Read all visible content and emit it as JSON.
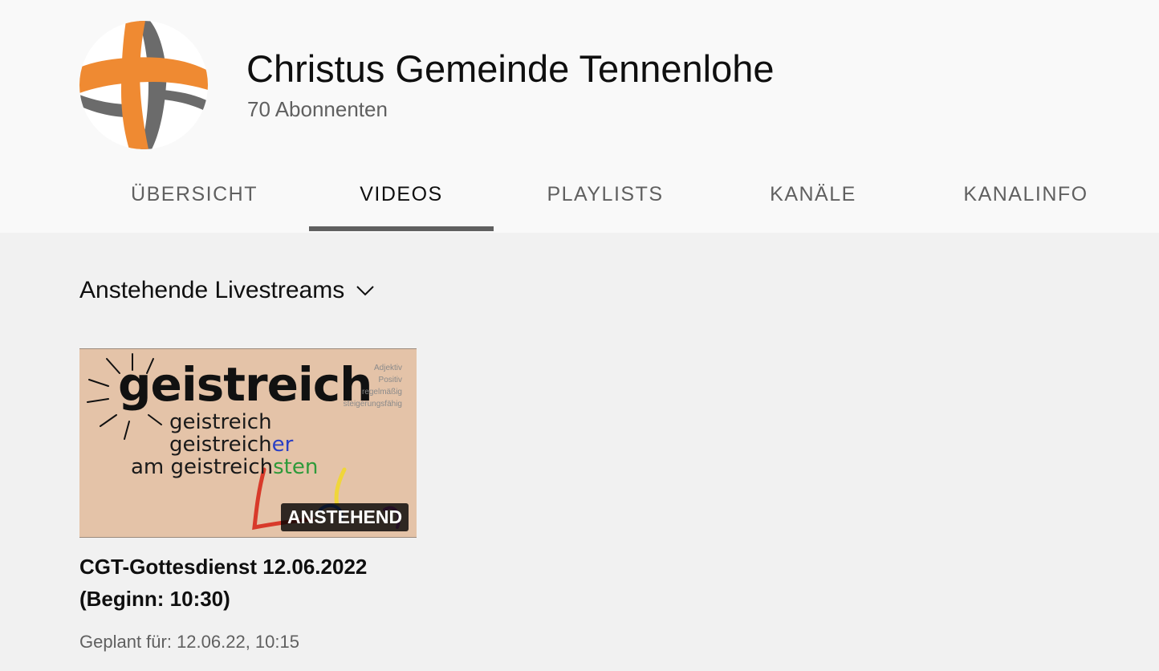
{
  "channel": {
    "name": "Christus Gemeinde Tennenlohe",
    "subscribers": "70 Abonnenten",
    "avatar_colors": {
      "orange": "#ef8a32",
      "gray": "#6b6b6b"
    }
  },
  "tabs": [
    {
      "label": "ÜBERSICHT",
      "active": false
    },
    {
      "label": "VIDEOS",
      "active": true
    },
    {
      "label": "PLAYLISTS",
      "active": false
    },
    {
      "label": "KANÄLE",
      "active": false
    },
    {
      "label": "KANALINFO",
      "active": false
    }
  ],
  "section": {
    "title": "Anstehende Livestreams",
    "icon": "chevron-down-icon"
  },
  "video": {
    "thumbnail": {
      "headline": "geistreich",
      "line1": "geistreich",
      "line2_prefix": "geistreich",
      "line2_suffix": "er",
      "line3_prefix": "am geistreich",
      "line3_suffix": "sten",
      "side_notes": [
        "Adjektiv",
        "Positiv",
        "regelmäßig",
        "steigerungsfähig"
      ],
      "background": "#e4c3a8"
    },
    "badge": "ANSTEHEND",
    "title": "CGT-Gottesdienst 12.06.2022 (Beginn: 10:30)",
    "meta": "Geplant für: 12.06.22, 10:15"
  }
}
